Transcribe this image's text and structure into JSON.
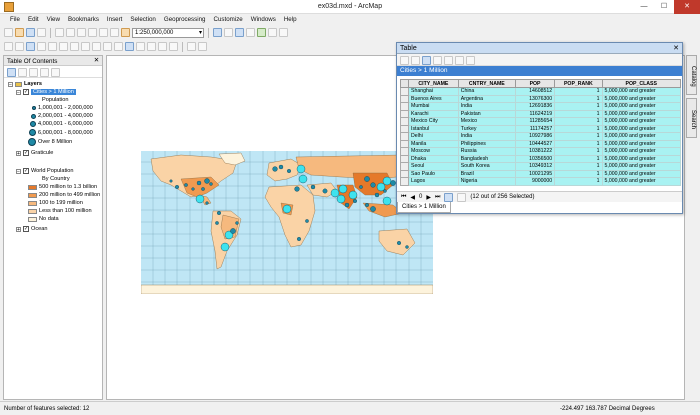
{
  "window": {
    "title": "ex03d.mxd - ArcMap",
    "minimize": "—",
    "maximize": "☐",
    "close": "✕"
  },
  "menu": [
    "File",
    "Edit",
    "View",
    "Bookmarks",
    "Insert",
    "Selection",
    "Geoprocessing",
    "Customize",
    "Windows",
    "Help"
  ],
  "toolbar": {
    "scale": "1:250,000,000"
  },
  "toc": {
    "title": "Table Of Contents",
    "close": "✕",
    "layers_label": "Layers",
    "cities_layer": "Cities > 1 Million",
    "population_label": "Population",
    "pop_classes": [
      "1,000,001 - 2,000,000",
      "2,000,001 - 4,000,000",
      "4,000,001 - 6,000,000",
      "6,000,001 - 8,000,000",
      "Over 8 Million"
    ],
    "graticule": "Graticule",
    "world_population": "World Population",
    "by_country": "By Country",
    "country_classes": [
      {
        "label": "500 million to 1.3 billion",
        "color": "#e5792a"
      },
      {
        "label": "200 million to 499 million",
        "color": "#f09a50"
      },
      {
        "label": "100 to 199 million",
        "color": "#f6b97e"
      },
      {
        "label": "Less than 100 million",
        "color": "#fad3a6"
      },
      {
        "label": "No data",
        "color": "#fdf3dc"
      }
    ],
    "ocean": "Ocean"
  },
  "table": {
    "title": "Table",
    "close": "✕",
    "layer_name": "Cities > 1 Million",
    "columns": [
      "CITY_NAME",
      "CNTRY_NAME",
      "POP",
      "POP_RANK",
      "POP_CLASS"
    ],
    "rows": [
      [
        "Shanghai",
        "China",
        "14608512",
        "1",
        "5,000,000 and greater"
      ],
      [
        "Buenos Aires",
        "Argentina",
        "13076300",
        "1",
        "5,000,000 and greater"
      ],
      [
        "Mumbai",
        "India",
        "12691836",
        "1",
        "5,000,000 and greater"
      ],
      [
        "Karachi",
        "Pakistan",
        "11624219",
        "1",
        "5,000,000 and greater"
      ],
      [
        "Mexico City",
        "Mexico",
        "11285654",
        "1",
        "5,000,000 and greater"
      ],
      [
        "Istanbul",
        "Turkey",
        "11174257",
        "1",
        "5,000,000 and greater"
      ],
      [
        "Delhi",
        "India",
        "10927986",
        "1",
        "5,000,000 and greater"
      ],
      [
        "Manila",
        "Philippines",
        "10444527",
        "1",
        "5,000,000 and greater"
      ],
      [
        "Moscow",
        "Russia",
        "10381222",
        "1",
        "5,000,000 and greater"
      ],
      [
        "Dhaka",
        "Bangladesh",
        "10356500",
        "1",
        "5,000,000 and greater"
      ],
      [
        "Seoul",
        "South Korea",
        "10349312",
        "1",
        "5,000,000 and greater"
      ],
      [
        "Sao Paulo",
        "Brazil",
        "10021295",
        "1",
        "5,000,000 and greater"
      ],
      [
        "Lagos",
        "Nigeria",
        "9000000",
        "1",
        "5,000,000 and greater"
      ]
    ],
    "record_index": "0",
    "selection_status": "(12 out of 256 Selected)",
    "tab_label": "Cities > 1 Million"
  },
  "sidetabs": [
    "Catalog",
    "Search"
  ],
  "status": {
    "features_selected": "Number of features selected: 12",
    "coordinates": "-224.497  163.787 Decimal Degrees"
  },
  "colors": {
    "ocean": "#bfe6f5",
    "city_fill": "#1f8aa6",
    "selected_row": "#a9f2f2",
    "selection_highlight": "#3ee3ee"
  }
}
